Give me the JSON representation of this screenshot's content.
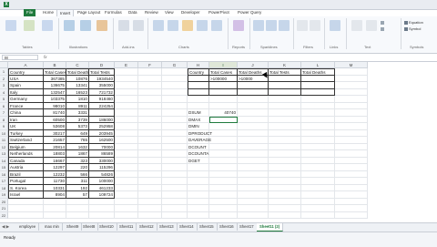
{
  "ribbon": {
    "tabs": [
      "File",
      "Home",
      "Insert",
      "Page Layout",
      "Formulas",
      "Data",
      "Review",
      "View",
      "Developer",
      "PowerPivot",
      "Power Query"
    ],
    "active_tab": "Insert",
    "groups": [
      "Tables",
      "Illustrations",
      "Add-ins",
      "Charts",
      "Reports",
      "Sparklines",
      "Filters",
      "Links",
      "Text",
      "Symbols"
    ],
    "buttons": [
      "PivotTable",
      "Recommended PivotTables",
      "Table",
      "Pictures",
      "Online Pictures",
      "Shapes",
      "Store",
      "My Add-ins",
      "Recommended Charts",
      "PivotChart",
      "Power View",
      "Line",
      "Column",
      "Win/Loss",
      "Slicer",
      "Timeline",
      "Hyperlink",
      "Text Box",
      "Header & Footer"
    ],
    "side_items": [
      "Equation",
      "Symbol"
    ]
  },
  "formula_bar": {
    "name_box": "I8",
    "fx": "fx",
    "formula": ""
  },
  "columns": [
    "A",
    "B",
    "C",
    "D",
    "E",
    "F",
    "G",
    "H",
    "I",
    "J",
    "K",
    "L",
    "M"
  ],
  "table": {
    "headers": [
      "Country",
      "Total Cases",
      "Total Deaths",
      "Total Tests"
    ],
    "rows": [
      [
        "USA",
        "367385",
        "10876",
        "1934540"
      ],
      [
        "Spain",
        "136675",
        "13341",
        "355000"
      ],
      [
        "Italy",
        "132547",
        "16523",
        "721732"
      ],
      [
        "Germany",
        "103375",
        "1810",
        "918460"
      ],
      [
        "France",
        "98010",
        "8911",
        "224254"
      ],
      [
        "China",
        "81740",
        "3331",
        ""
      ],
      [
        "Iran",
        "60500",
        "3739",
        "186000"
      ],
      [
        "UK",
        "53608",
        "5373",
        "252958"
      ],
      [
        "Turkey",
        "30217",
        "649",
        "203945"
      ],
      [
        "Switzerland",
        "21657",
        "765",
        "162500"
      ],
      [
        "Belgium",
        "20814",
        "1632",
        "70000"
      ],
      [
        "Netherlands",
        "18803",
        "1867",
        "86589"
      ],
      [
        "Canada",
        "16667",
        "323",
        "330000"
      ],
      [
        "Austria",
        "12297",
        "220",
        "115296"
      ],
      [
        "Brazil",
        "12232",
        "566",
        "54826"
      ],
      [
        "Portugal",
        "11730",
        "311",
        "100000"
      ],
      [
        "S. Korea",
        "10331",
        "192",
        "461233"
      ],
      [
        "Israel",
        "8904",
        "57",
        "109724"
      ]
    ]
  },
  "criteria": {
    "headers": [
      "Country",
      "Total Cases",
      "Total Deaths",
      "Total Tests",
      "Total Deaths"
    ],
    "row1": [
      "",
      ">100000",
      ">10000",
      "",
      ""
    ]
  },
  "functions": [
    "DSUM",
    "DMAX",
    "DMIN",
    "DPRODUCT",
    "DAVERAGE",
    "DCOUNT",
    "DCOUNTA",
    "DGET"
  ],
  "dsum_value": "40740",
  "sheets": [
    "employee",
    "max min",
    "Sheet9",
    "Sheet8",
    "Sheet10",
    "Sheet11",
    "Sheet12",
    "Sheet13",
    "Sheet14",
    "Sheet15",
    "Sheet16",
    "Sheet17",
    "Sheet11 (2)"
  ],
  "active_sheet": "Sheet11 (2)",
  "colors": {
    "excel_green": "#1f7a3d"
  },
  "status": {
    "ready": "Ready"
  }
}
